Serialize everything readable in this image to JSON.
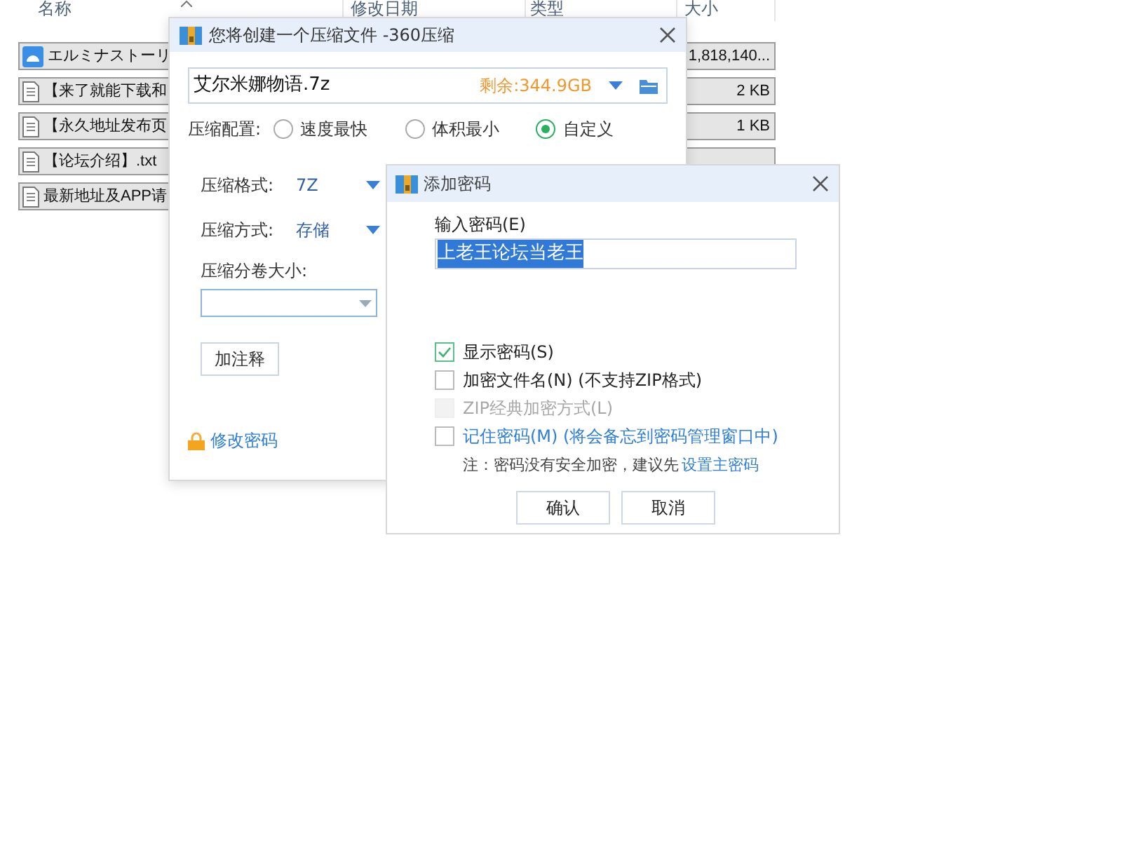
{
  "explorer": {
    "columns": [
      {
        "label": "名称"
      },
      {
        "label": "修改日期"
      },
      {
        "label": "类型"
      },
      {
        "label": "大小"
      }
    ],
    "rows": [
      {
        "kind": "app",
        "name": "エルミナストーリ",
        "size": "1,818,140...",
        "selected": true
      },
      {
        "kind": "text",
        "name": "【来了就能下载和",
        "size": "2 KB",
        "selected": true
      },
      {
        "kind": "text",
        "name": "【永久地址发布页",
        "size": "1 KB",
        "selected": true
      },
      {
        "kind": "text",
        "name": "【论坛介绍】.txt",
        "selected": true
      },
      {
        "kind": "text",
        "name": "最新地址及APP请",
        "selected": true
      }
    ]
  },
  "compress_dialog": {
    "title": "您将创建一个压缩文件 -360压缩",
    "path": "艾尔米娜物语.7z",
    "free_space": "剩余:344.9GB",
    "profile_label": "压缩配置:",
    "profiles": [
      {
        "label": "速度最快",
        "selected": false
      },
      {
        "label": "体积最小",
        "selected": false
      },
      {
        "label": "自定义",
        "selected": true
      }
    ],
    "format_label": "压缩格式:",
    "format": "7Z",
    "method_label": "压缩方式:",
    "method": "存储",
    "split_label": "压缩分卷大小:",
    "comment_button": "加注释",
    "change_password_link": "修改密码"
  },
  "password_dialog": {
    "title": "添加密码",
    "input_label": "输入密码(E)",
    "password": "上老王论坛当老王",
    "options": [
      {
        "kind": "normal",
        "label": "显示密码(S)",
        "checked": true,
        "disabled": false
      },
      {
        "kind": "normal",
        "label": "加密文件名(N) (不支持ZIP格式)",
        "checked": false,
        "disabled": false
      },
      {
        "kind": "normal",
        "label": "ZIP经典加密方式(L)",
        "checked": false,
        "disabled": true
      },
      {
        "kind": "link",
        "label": "记住密码(M) (将会备忘到密码管理窗口中)",
        "checked": false,
        "disabled": false
      }
    ],
    "note": "注：密码没有安全加密，建议先",
    "note_link": "设置主密码",
    "buttons": [
      "确认",
      "取消"
    ]
  }
}
